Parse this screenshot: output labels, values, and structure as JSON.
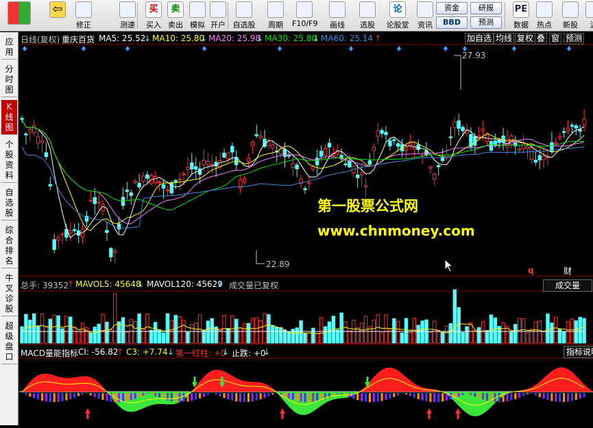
{
  "toolbar": {
    "buttons": [
      {
        "label": "",
        "icon": "grid-icon"
      },
      {
        "label": "",
        "icon": "back-arrow-icon"
      },
      {
        "label": "修正",
        "icon": "revise-icon"
      },
      {
        "label": "测速",
        "icon": "speed-test-icon"
      },
      {
        "label": "买入",
        "icon": "buy-icon",
        "glyph": "买"
      },
      {
        "label": "卖出",
        "icon": "sell-icon",
        "glyph": "卖"
      },
      {
        "label": "模拟",
        "icon": "hammer-icon"
      },
      {
        "label": "开户",
        "icon": "lock-icon"
      },
      {
        "label": "自选股",
        "icon": "favorites-icon"
      },
      {
        "label": "周期",
        "icon": "clock-icon"
      },
      {
        "label": "F10/F9",
        "icon": "f10-icon"
      },
      {
        "label": "画线",
        "icon": "pencil-icon"
      },
      {
        "label": "选股",
        "icon": "screen-icon"
      },
      {
        "label": "论股堂",
        "icon": "forum-icon",
        "glyph": "论"
      },
      {
        "label": "资讯",
        "icon": "news-icon"
      },
      {
        "label": "数据",
        "icon": "pe-icon",
        "glyph": "PE"
      },
      {
        "label": "热点",
        "icon": "hot-icon"
      },
      {
        "label": "新股",
        "icon": "new-stock-icon"
      },
      {
        "label": "沪",
        "icon": "sh-icon"
      }
    ],
    "small": {
      "zijin": "资金",
      "yanbao": "研报",
      "bbd": "BBD",
      "yuce": "预测"
    }
  },
  "sidebar": [
    {
      "label": "应用"
    },
    {
      "label": "分时图"
    },
    {
      "label": "K线图",
      "active": true
    },
    {
      "label": "个股资料"
    },
    {
      "label": "自选股"
    },
    {
      "label": "综合排名"
    },
    {
      "label": "牛叉诊股"
    },
    {
      "label": "超级盘口"
    }
  ],
  "kline_header": {
    "period": "日线(复权)",
    "stock": "重庆百货",
    "ma5": "MA5: 25.52",
    "ma10": "MA10: 25.80",
    "ma20": "MA20: 25.98",
    "ma30": "MA30: 25.80",
    "ma60": "MA60: 25.14",
    "arrows": [
      "↓",
      "↓",
      "↓",
      "↓",
      "↑"
    ]
  },
  "right_buttons": [
    "加自选",
    "均线",
    "复权",
    "叠",
    "窗",
    "预测"
  ],
  "high_label": "27.93",
  "low_label": "22.89",
  "vol_header": {
    "total": "总手: 39352",
    "mavol5": "MAVOL5: 45648",
    "mavol120": "MAVOL120: 45629",
    "note": "成交量已复权",
    "arrows": [
      "↑",
      "↓",
      "↓"
    ]
  },
  "vol_tab": "成交量",
  "q_label": "q",
  "cai_label": "财",
  "macd_header": {
    "title": "MACD量能指标",
    "ci": "CI: -56.82",
    "c3": "C3: +7.74",
    "redcol": "第一红柱: +0",
    "stop": "止跌: +0",
    "arrows": [
      "↑",
      "↓",
      "↓",
      "↓"
    ]
  },
  "indicator_btn": "指标说明",
  "watermark": {
    "line1": "第一股票公式网",
    "line2": "www.chnmoney.com"
  },
  "colors": {
    "up": "#ff3232",
    "down": "#54fcfc",
    "ma5": "#ffffff",
    "ma10": "#ffff00",
    "ma20": "#ff80ff",
    "ma30": "#00e600",
    "ma60": "#3a8ee6",
    "watermark": "#ffff00"
  }
}
